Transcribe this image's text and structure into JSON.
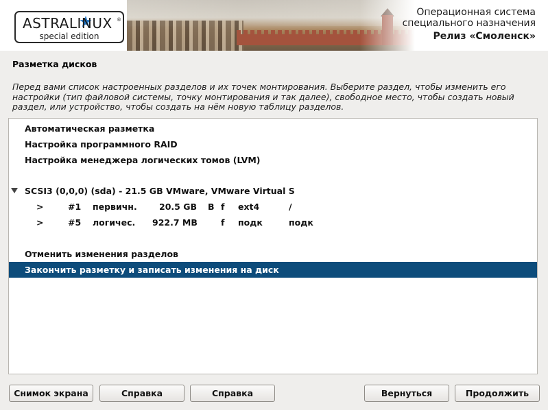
{
  "header": {
    "logo_text": "ASTRALINUX",
    "logo_registered": "®",
    "logo_subtitle": "special edition",
    "os_line1": "Операционная система",
    "os_line2": "специального назначения",
    "release": "Релиз «Смоленск»"
  },
  "page": {
    "title": "Разметка дисков",
    "description": "Перед вами список настроенных разделов и их точек монтирования. Выберите раздел, чтобы изменить его настройки (тип файловой системы, точку монтирования и так далее), свободное место, чтобы создать новый раздел, или устройство, чтобы создать на нём новую таблицу разделов."
  },
  "list": {
    "guided": "Автоматическая разметка",
    "raid": "Настройка программного RAID",
    "lvm": "Настройка менеджера логических томов (LVM)",
    "disk": "SCSI3 (0,0,0) (sda) - 21.5 GB VMware, VMware Virtual S",
    "partitions": [
      {
        "arrow": ">",
        "num": "#1",
        "type": "первичн.",
        "size": "20.5 GB",
        "bootable": "B",
        "format": "f",
        "fs": "ext4",
        "mount": "/"
      },
      {
        "arrow": ">",
        "num": "#5",
        "type": "логичес.",
        "size": "922.7 MB",
        "bootable": "",
        "format": "f",
        "fs": "подк",
        "mount": "подк"
      }
    ],
    "undo": "Отменить изменения разделов",
    "finish": "Закончить разметку и записать изменения на диск",
    "selected_item": "finish"
  },
  "buttons": {
    "screenshot": "Снимок экрана",
    "help1": "Справка",
    "help2": "Справка",
    "back": "Вернуться",
    "continue": "Продолжить"
  },
  "colors": {
    "selection": "#0d4c7b",
    "logo_star": "#1f76c8"
  }
}
